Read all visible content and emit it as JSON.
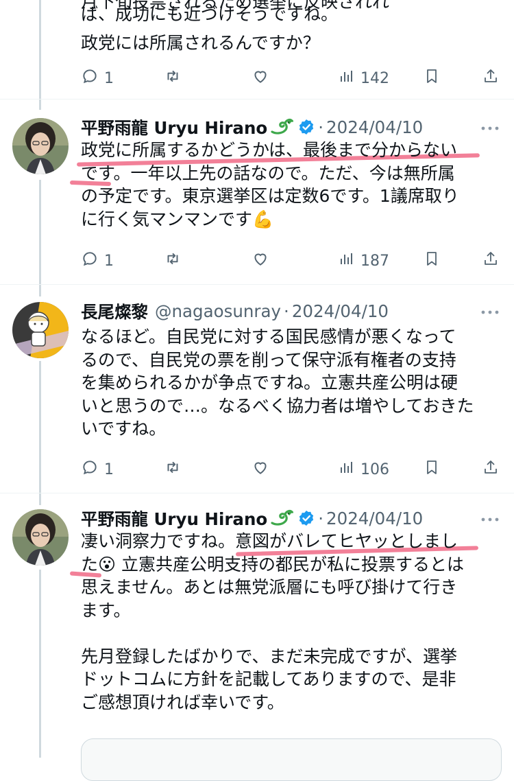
{
  "previous_post": {
    "cut_line": "月下旬投票されるため選挙に反映されれ",
    "lines": [
      "ば、成功にも近づけそうですね。",
      "政党には所属されるんですか？"
    ],
    "replies": "1",
    "views": "142"
  },
  "posts": [
    {
      "name": "平野雨龍 Uryu Hirano",
      "handle": "",
      "date": "2024/04/10",
      "verified": true,
      "text": "政党に所属するかどうかは、最後まで分からない\nです。一年以上先の話なので。ただ、今は無所属\nの予定です。東京選挙区は定数6です。1議席取り\nに行く気マンマンです💪",
      "replies": "1",
      "views": "187"
    },
    {
      "name": "長尾燦黎",
      "handle": "@nagaosunray",
      "date": "2024/04/10",
      "verified": false,
      "text": "なるほど。自民党に対する国民感情が悪くなって\nるので、自民党の票を削って保守派有権者の支持\nを集められるかが争点ですね。立憲共産公明は硬\nいと思うので…。なるべく協力者は増やしておきた\nいですね。",
      "replies": "1",
      "views": "106"
    },
    {
      "name": "平野雨龍 Uryu Hirano",
      "handle": "",
      "date": "2024/04/10",
      "verified": true,
      "text": "凄い洞察力ですね。意図がバレてヒヤッとしまし\nた😮 立憲共産公明支持の都民が私に投票するとは\n思えません。あとは無党派層にも呼び掛けて行き\nます。\n\n先月登録したばかりで、まだ未完成ですが、選挙\nドットコムに方針を記載してありますので、是非\nご感想頂ければ幸いです。"
    }
  ],
  "colors": {
    "text": "#0f1419",
    "secondary": "#536471",
    "verified": "#1d9bf0",
    "highlight": "#f06a86"
  },
  "icons": [
    "reply-icon",
    "repost-icon",
    "like-icon",
    "views-icon",
    "bookmark-icon",
    "share-icon",
    "verified-badge-icon",
    "dragon-emoji-icon",
    "more-icon"
  ]
}
